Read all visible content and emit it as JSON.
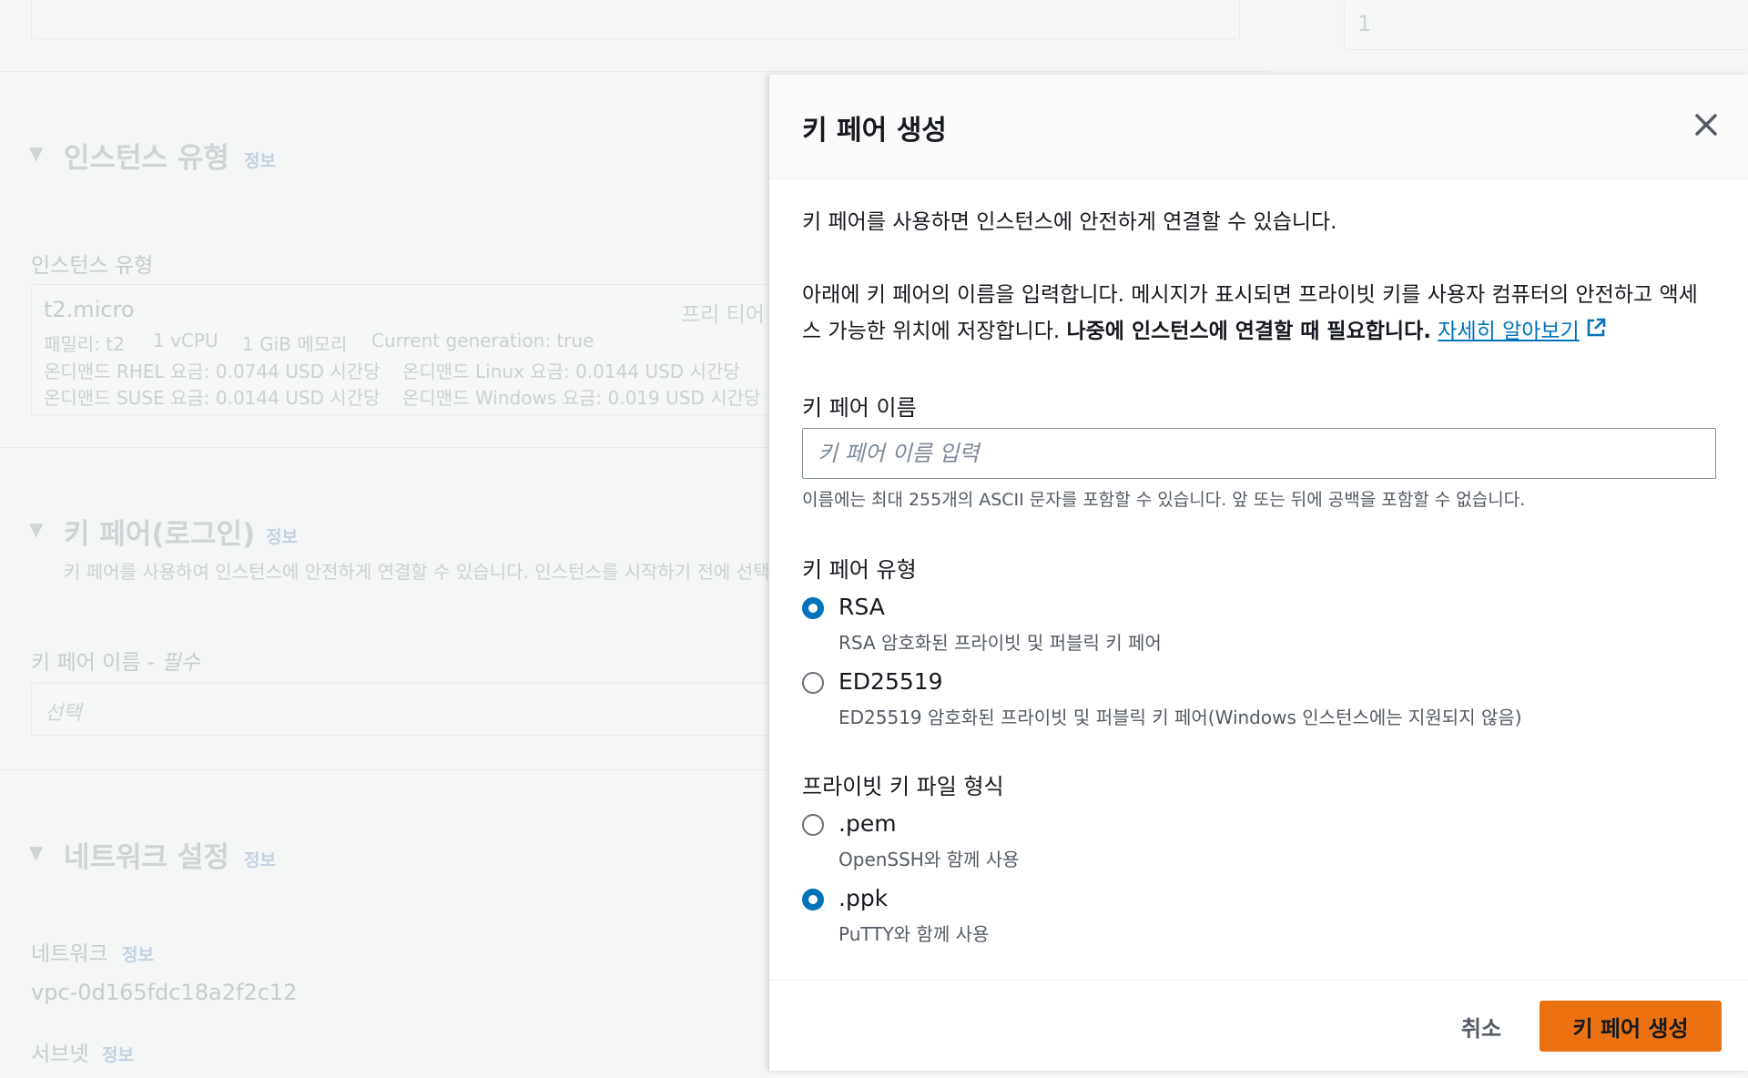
{
  "background": {
    "top_right_value": "1",
    "instance_type_section": {
      "title": "인스턴스 유형",
      "info": "정보",
      "label": "인스턴스 유형",
      "selected": "t2.micro",
      "tier": "프리 티어",
      "details": [
        "패밀리: t2",
        "1 vCPU",
        "1 GiB 메모리",
        "Current generation: true"
      ],
      "pricing": [
        "온디맨드 RHEL 요금: 0.0744 USD 시간당",
        "온디맨드 Linux 요금: 0.0144 USD 시간당",
        "온디맨드 SUSE 요금: 0.0144 USD 시간당",
        "온디맨드 Windows 요금: 0.019 USD 시간당"
      ]
    },
    "key_pair_section": {
      "title": "키 페어(로그인)",
      "info": "정보",
      "description": "키 페어를 사용하여 인스턴스에 안전하게 연결할 수 있습니다. 인스턴스를 시작하기 전에 선택",
      "name_label": "키 페어 이름 -",
      "required": "필수",
      "select_placeholder": "선택"
    },
    "network_section": {
      "title": "네트워크 설정",
      "info": "정보",
      "network_label": "네트워크",
      "network_info": "정보",
      "vpc": "vpc-0d165fdc18a2f2c12",
      "subnet_label": "서브넷",
      "subnet_info": "정보"
    }
  },
  "modal": {
    "title": "키 페어 생성",
    "intro": "키 페어를 사용하면 인스턴스에 안전하게 연결할 수 있습니다.",
    "desc_line1": "아래에 키 페어의 이름을 입력합니다. 메시지가 표시되면 프라이빗 키를 사용자 컴퓨터의 안전하고 액세",
    "desc_line2": "스 가능한 위치에 저장합니다.",
    "desc_bold": "나중에 인스턴스에 연결할 때 필요합니다.",
    "learn_more": "자세히 알아보기",
    "name_label": "키 페어 이름",
    "name_placeholder": "키 페어 이름 입력",
    "name_value": "",
    "name_hint": "이름에는 최대 255개의 ASCII 문자를 포함할 수 있습니다. 앞 또는 뒤에 공백을 포함할 수 없습니다.",
    "type_label": "키 페어 유형",
    "types": [
      {
        "label": "RSA",
        "desc": "RSA 암호화된 프라이빗 및 퍼블릭 키 페어",
        "selected": true
      },
      {
        "label": "ED25519",
        "desc": "ED25519 암호화된 프라이빗 및 퍼블릭 키 페어(Windows 인스턴스에는 지원되지 않음)",
        "selected": false
      }
    ],
    "format_label": "프라이빗 키 파일 형식",
    "formats": [
      {
        "label": ".pem",
        "desc": "OpenSSH와 함께 사용",
        "selected": false
      },
      {
        "label": ".ppk",
        "desc": "PuTTY와 함께 사용",
        "selected": true
      }
    ],
    "cancel_label": "취소",
    "create_label": "키 페어 생성"
  },
  "colors": {
    "primary_button": "#ec7211",
    "radio_selected": "#0073bb",
    "link": "#0073bb"
  },
  "icons": [
    "close-icon",
    "external-link-icon",
    "caret-down-icon"
  ]
}
